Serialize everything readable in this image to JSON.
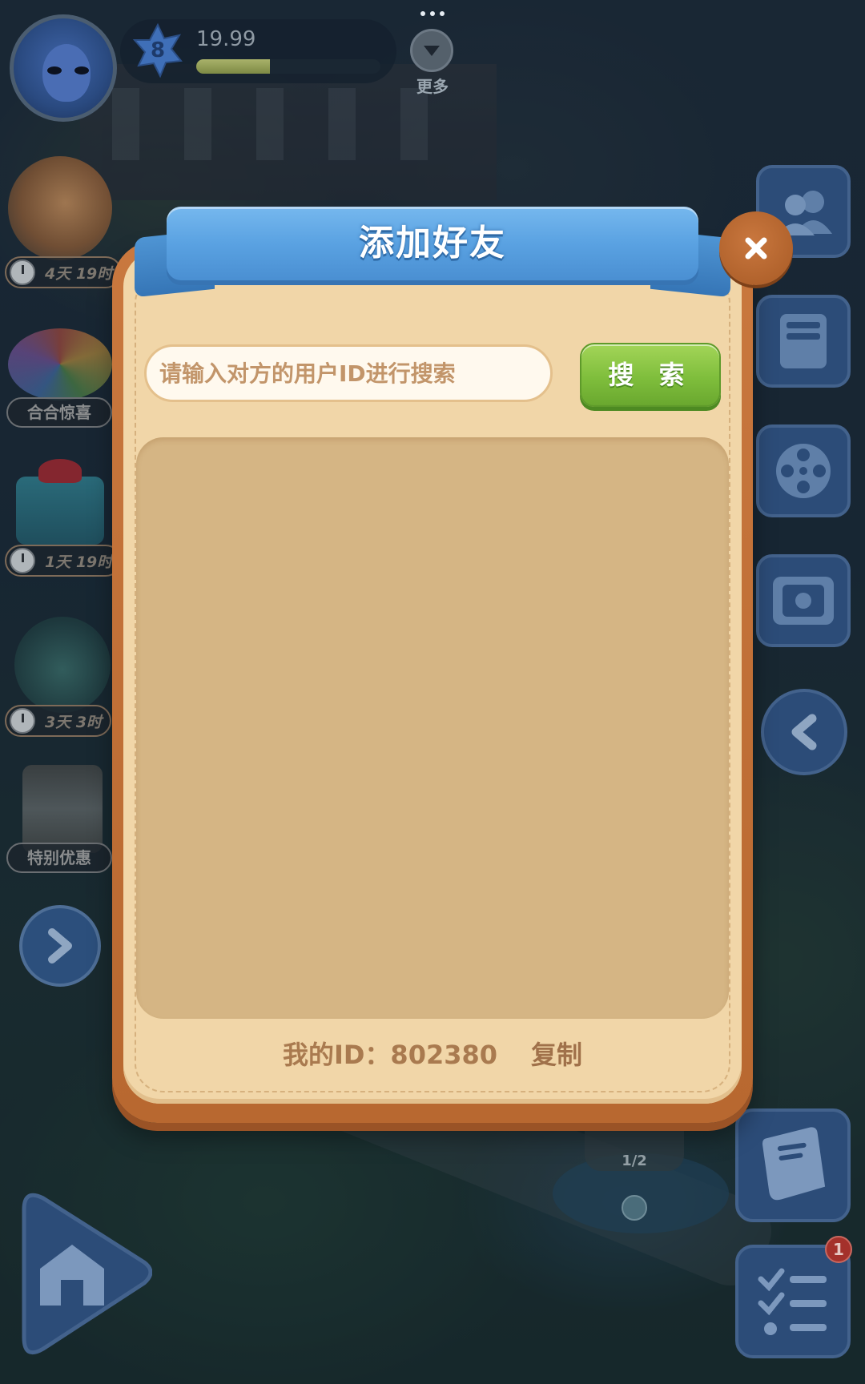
{
  "top_bar": {
    "level": "8",
    "xp_value": "19.99",
    "xp_progress": 0.4,
    "more_label": "更多"
  },
  "left_events": {
    "pony_timer": "4天 19时",
    "wheel_label": "合合惊喜",
    "gift_timer": "1天 19时",
    "flask_timer": "3天 3时",
    "offer_label": "特别优惠"
  },
  "checkpoint": {
    "progress": "1/2"
  },
  "notifications": {
    "tasks_badge": "1"
  },
  "dialog": {
    "title": "添加好友",
    "search_placeholder": "请输入对方的用户ID进行搜索",
    "search_value": "",
    "search_button": "搜 索",
    "my_id_label": "我的ID：802380",
    "copy_label": "复制"
  },
  "colors": {
    "dialog_bg": "#f1d6a8",
    "dialog_border": "#c9783e",
    "ribbon_blue": "#5aa2e2",
    "search_green": "#7fbe3c",
    "results_bg": "#d5b584"
  },
  "icons": {
    "close": "close-icon",
    "friends": "friends-icon",
    "album": "album-icon",
    "film": "film-reel-icon",
    "frame": "picture-frame-icon",
    "back": "chevron-left-icon",
    "forward": "chevron-right-icon",
    "journal": "journal-icon",
    "tasks": "checklist-icon",
    "home": "home-icon",
    "more": "triangle-down-icon"
  }
}
